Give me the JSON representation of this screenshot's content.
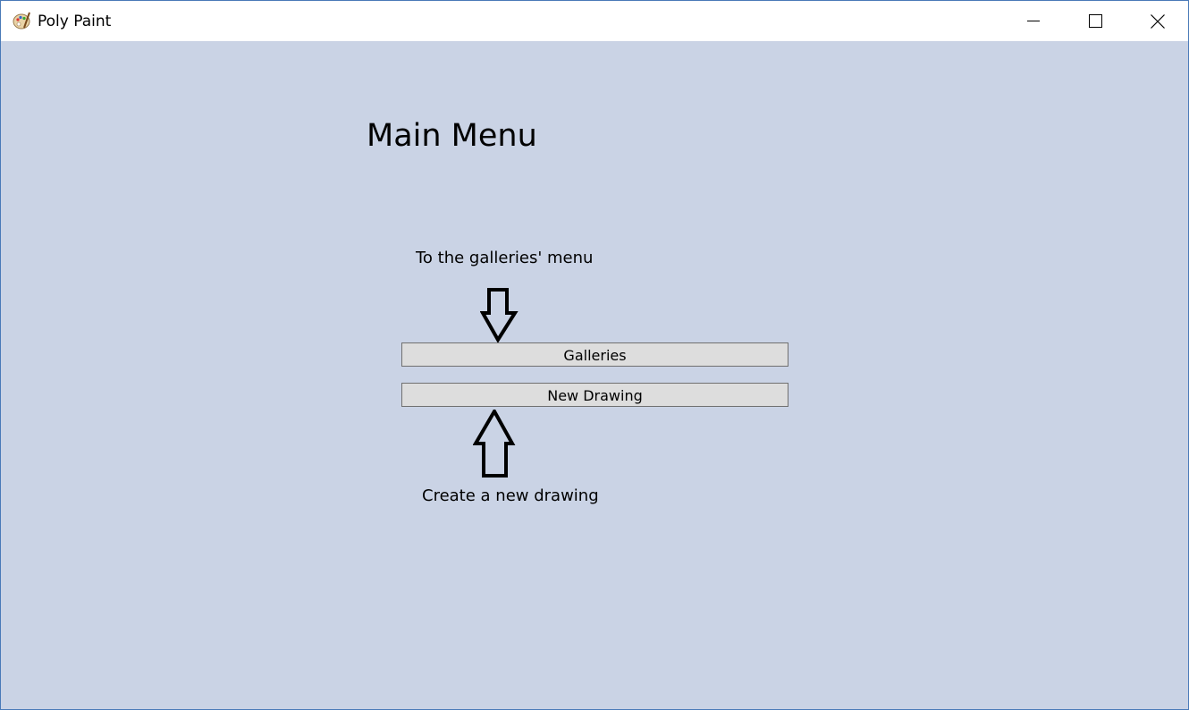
{
  "window": {
    "title": "Poly Paint",
    "icon": "palette-icon",
    "controls": [
      "minimize-icon",
      "maximize-icon",
      "close-icon"
    ]
  },
  "main": {
    "heading": "Main Menu",
    "galleries_hint": "To the galleries' menu",
    "galleries_button": "Galleries",
    "new_drawing_button": "New Drawing",
    "new_drawing_hint": "Create a new drawing"
  },
  "colors": {
    "background": "#cad3e5",
    "button_fill": "#dddddd",
    "button_border": "#707070"
  }
}
